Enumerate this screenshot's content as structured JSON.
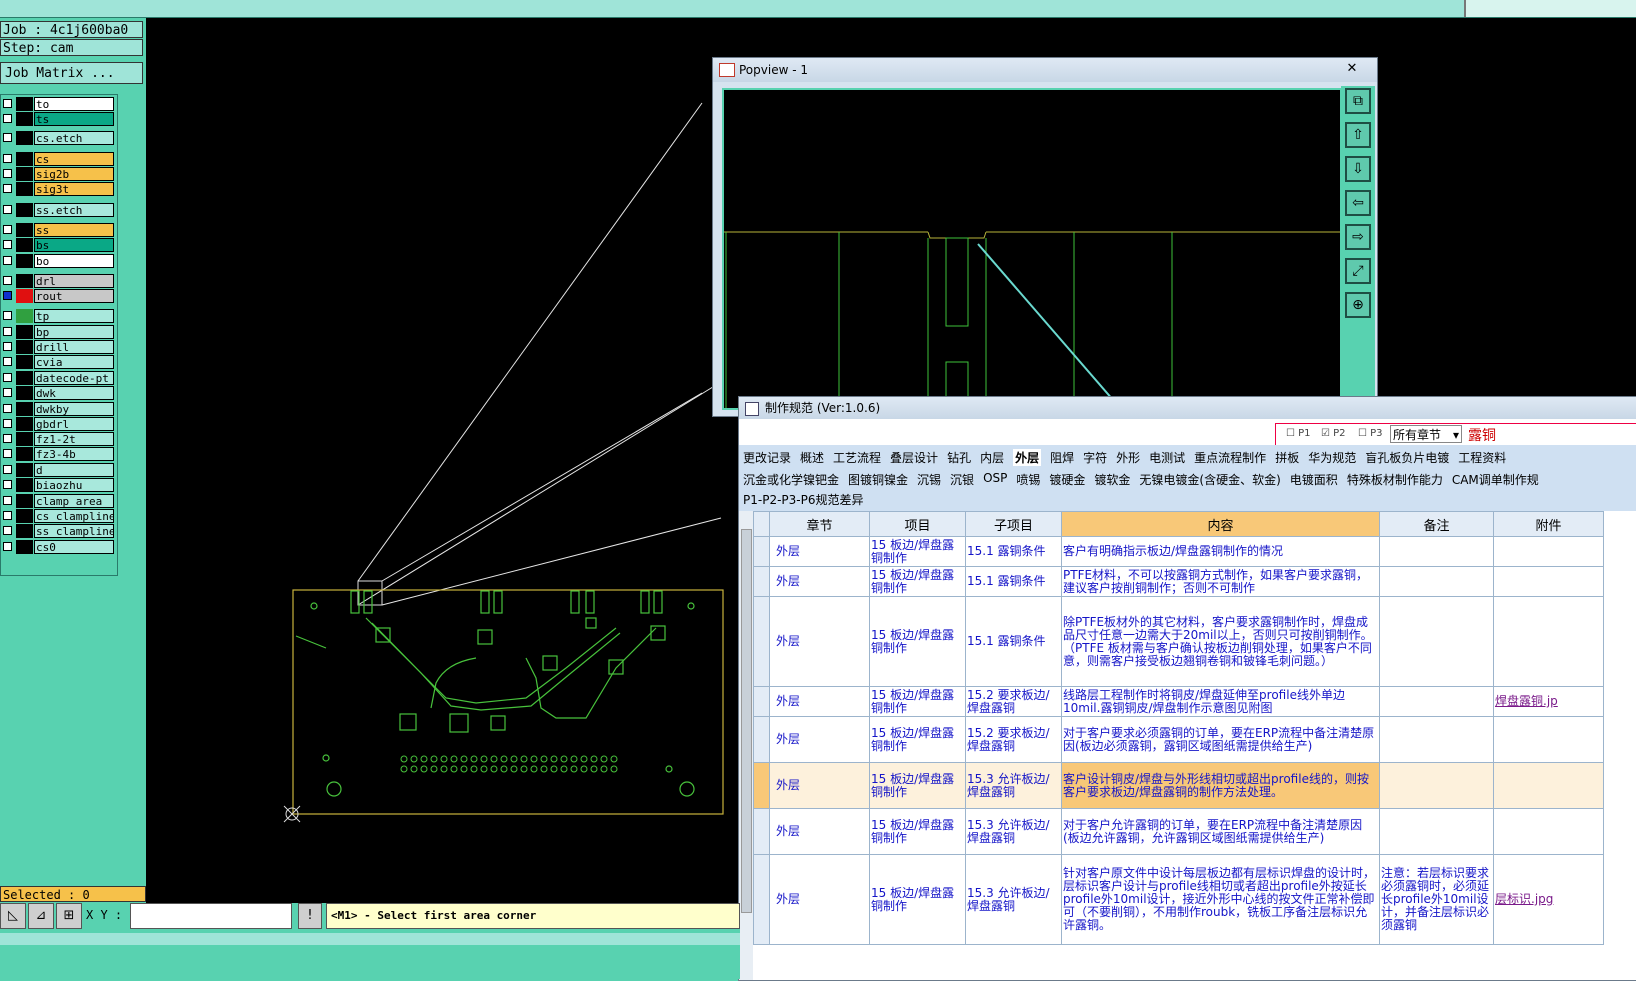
{
  "job": {
    "job_text": "Job : 4c1j600ba0",
    "step_text": "Step: cam",
    "matrix_btn": "Job Matrix ..."
  },
  "layers": [
    {
      "name": "to",
      "color": "#ffffff"
    },
    {
      "name": "ts",
      "color": "#0aa886"
    },
    {
      "name": "cs.etch",
      "color": "#a8e8dc"
    },
    {
      "name": "cs",
      "color": "#f6c14a"
    },
    {
      "name": "sig2b",
      "color": "#f6c14a"
    },
    {
      "name": "sig3t",
      "color": "#f6c14a"
    },
    {
      "name": "ss.etch",
      "color": "#a8e8dc"
    },
    {
      "name": "ss",
      "color": "#f6c14a"
    },
    {
      "name": "bs",
      "color": "#0aa886"
    },
    {
      "name": "bo",
      "color": "#ffffff"
    },
    {
      "name": "drl",
      "color": "#c8c8c8"
    },
    {
      "name": "rout",
      "color": "#c8c8c8"
    },
    {
      "name": "tp",
      "color": "#a8e8dc"
    },
    {
      "name": "bp",
      "color": "#a8e8dc"
    },
    {
      "name": "drill",
      "color": "#a8e8dc"
    },
    {
      "name": "cvia",
      "color": "#a8e8dc"
    },
    {
      "name": "datecode-pt",
      "color": "#a8e8dc"
    },
    {
      "name": "dwk",
      "color": "#a8e8dc"
    },
    {
      "name": "dwkby",
      "color": "#a8e8dc"
    },
    {
      "name": "gbdrl",
      "color": "#a8e8dc"
    },
    {
      "name": "fz1-2t",
      "color": "#a8e8dc"
    },
    {
      "name": "fz3-4b",
      "color": "#a8e8dc"
    },
    {
      "name": "d",
      "color": "#a8e8dc"
    },
    {
      "name": "biaozhu",
      "color": "#a8e8dc"
    },
    {
      "name": "clamp_area",
      "color": "#a8e8dc"
    },
    {
      "name": "cs_clampline",
      "color": "#a8e8dc"
    },
    {
      "name": "ss_clampline",
      "color": "#a8e8dc"
    },
    {
      "name": "cs0",
      "color": "#a8e8dc"
    }
  ],
  "status": {
    "selected": "Selected : 0",
    "xy_label": "X Y :",
    "xy_value": "",
    "hint": "<M1> - Select first area corner"
  },
  "popview": {
    "title": "Popview - 1",
    "close": "✕"
  },
  "spec": {
    "title": "制作规范 (Ver:1.0.6)",
    "filters": {
      "p1": "P1",
      "p2": "P2",
      "p3": "P3",
      "chapter": "所有章节",
      "search": "露铜"
    },
    "tabs_row1": [
      "更改记录",
      "概述",
      "工艺流程",
      "叠层设计",
      "钻孔",
      "内层",
      "外层",
      "阻焊",
      "字符",
      "外形",
      "电测试",
      "重点流程制作",
      "拼板",
      "华为规范",
      "盲孔板负片电镀",
      "工程资料"
    ],
    "tabs_row2": [
      "沉金或化学镍钯金",
      "图镀铜镍金",
      "沉锡",
      "沉银",
      "OSP",
      "喷锡",
      "镀硬金",
      "镀软金",
      "无镍电镀金(含硬金、软金)",
      "电镀面积",
      "特殊板材制作能力",
      "CAM调单制作规"
    ],
    "tabs_row3": [
      "P1-P2-P3-P6规范差异"
    ],
    "headers": [
      "章节",
      "项目",
      "子项目",
      "内容",
      "备注",
      "附件"
    ],
    "rows": [
      {
        "chapter": "外层",
        "item": "15 板边/焊盘露铜制作",
        "sub": "15.1 露铜条件",
        "content": "客户有明确指示板边/焊盘露铜制作的情况",
        "note": "",
        "attach": ""
      },
      {
        "chapter": "外层",
        "item": "15 板边/焊盘露铜制作",
        "sub": "15.1 露铜条件",
        "content": "PTFE材料，不可以按露铜方式制作，如果客户要求露铜，建议客户按削铜制作；否则不可制作",
        "note": "",
        "attach": ""
      },
      {
        "chapter": "外层",
        "item": "15 板边/焊盘露铜制作",
        "sub": "15.1 露铜条件",
        "content": "除PTFE板材外的其它材料，客户要求露铜制作时，焊盘成品尺寸任意一边需大于20mil以上，否则只可按削铜制作。（PTFE 板材需与客户确认按板边削铜处理，如果客户不同意，则需客户接受板边翘铜卷铜和铍锋毛刺问题。）",
        "note": "",
        "attach": ""
      },
      {
        "chapter": "外层",
        "item": "15 板边/焊盘露铜制作",
        "sub": "15.2 要求板边/焊盘露铜",
        "content": "线路层工程制作时将铜皮/焊盘延伸至profile线外单边10mil.露铜铜皮/焊盘制作示意图见附图",
        "note": "",
        "attach": "焊盘露铜.jp"
      },
      {
        "chapter": "外层",
        "item": "15 板边/焊盘露铜制作",
        "sub": "15.2 要求板边/焊盘露铜",
        "content": "对于客户要求必须露铜的订单，要在ERP流程中备注清楚原因(板边必须露铜，露铜区域图纸需提供给生产)",
        "note": "",
        "attach": ""
      },
      {
        "chapter": "外层",
        "item": "15 板边/焊盘露铜制作",
        "sub": "15.3 允许板边/焊盘露铜",
        "content": "客户设计铜皮/焊盘与外形线相切或超出profile线的，则按客户要求板边/焊盘露铜的制作方法处理。",
        "note": "",
        "attach": "",
        "highlight": true
      },
      {
        "chapter": "外层",
        "item": "15 板边/焊盘露铜制作",
        "sub": "15.3 允许板边/焊盘露铜",
        "content": "对于客户允许露铜的订单，要在ERP流程中备注清楚原因(板边允许露铜，允许露铜区域图纸需提供给生产)",
        "note": "",
        "attach": ""
      },
      {
        "chapter": "外层",
        "item": "15 板边/焊盘露铜制作",
        "sub": "15.3 允许板边/焊盘露铜",
        "content": "针对客户原文件中设计每层板边都有层标识焊盘的设计时，层标识客户设计与profile线相切或者超出profile外按延长profile外10mil设计，接近外形中心线的按文件正常补偿即可（不要削铜），不用制作roubk，铣板工序备注层标识允许露铜。",
        "note": "注意：若层标识要求必须露铜时，必须延长profile外10mil设计，并备注层标识必须露铜",
        "attach": "层标识.jpg"
      }
    ]
  }
}
